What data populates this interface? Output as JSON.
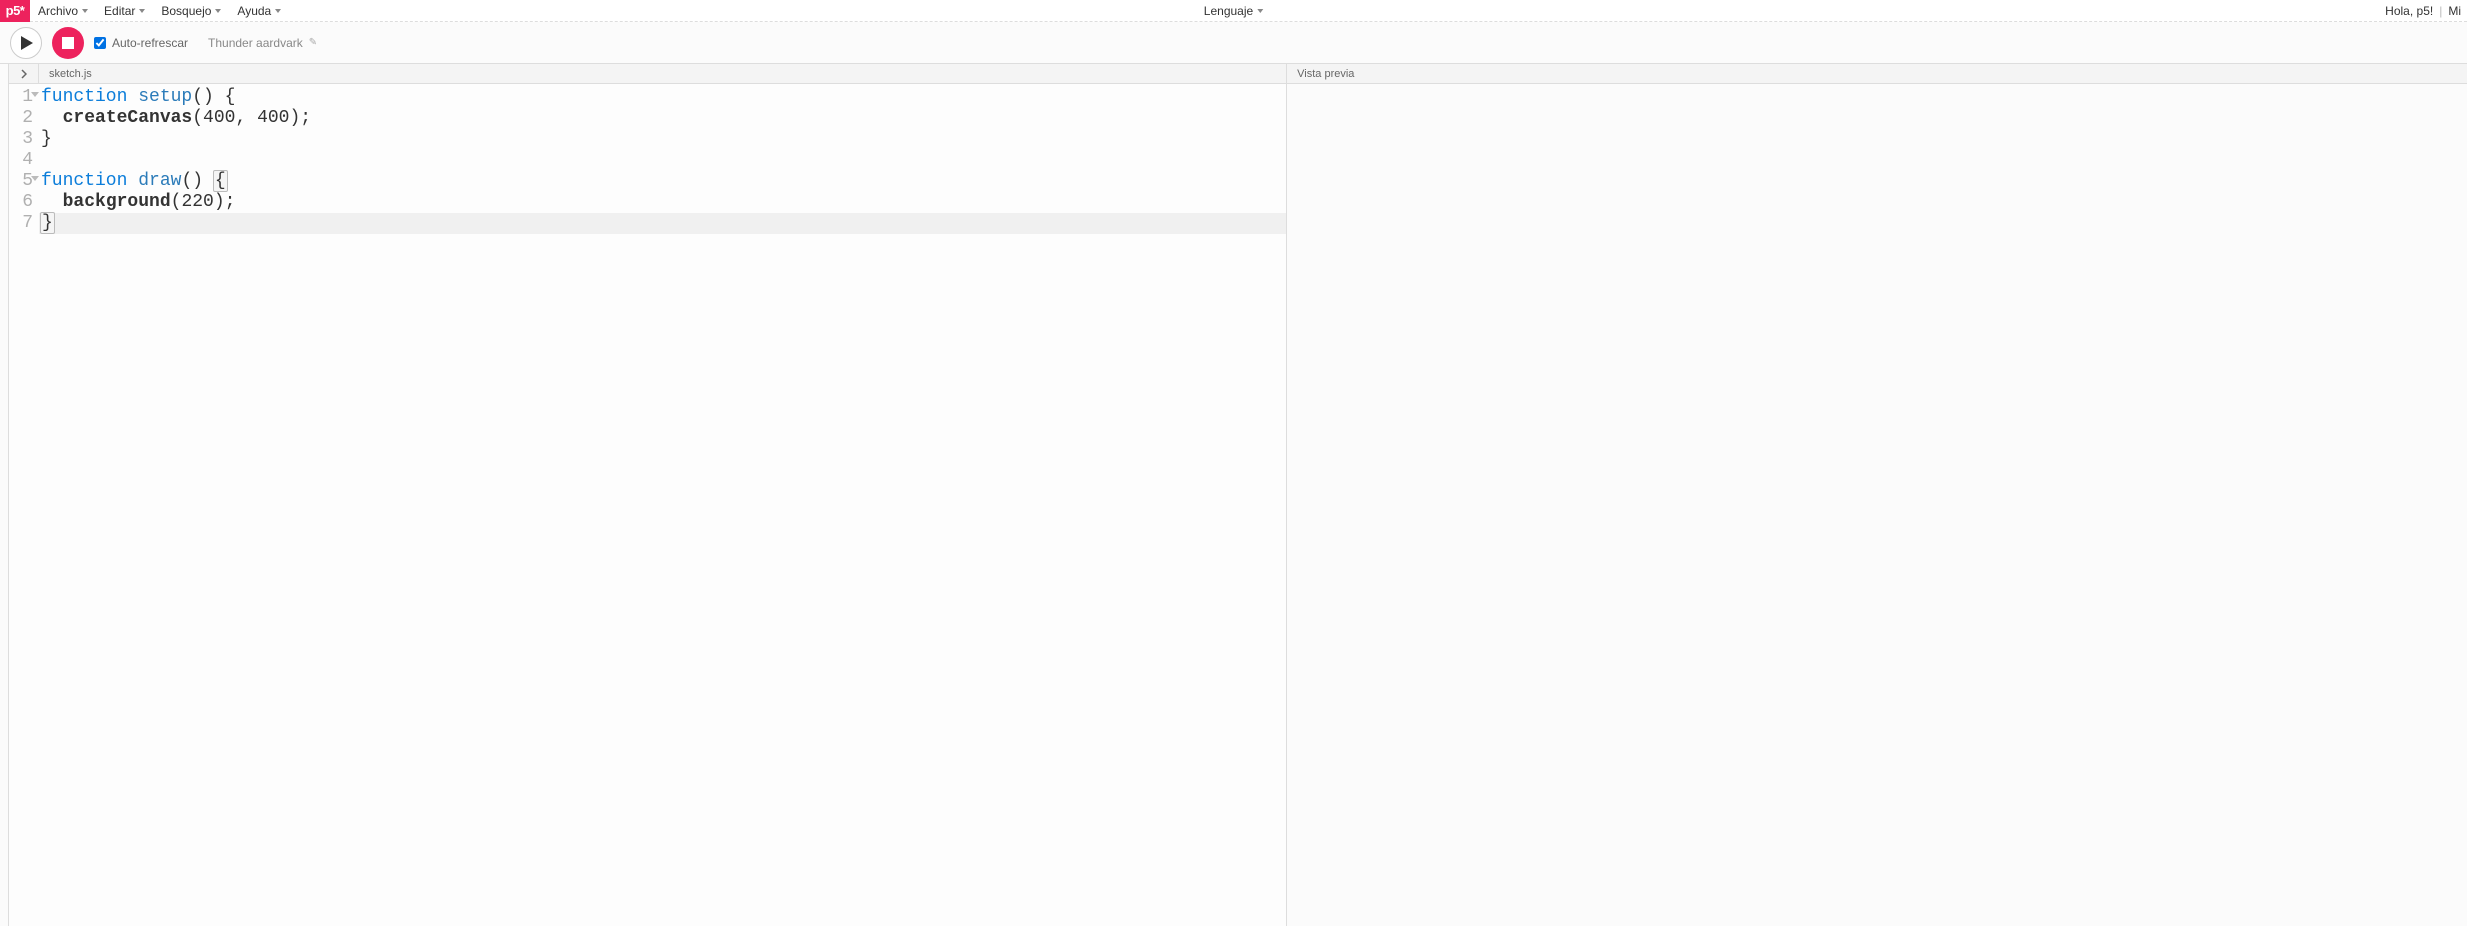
{
  "logo": "p5*",
  "menu": {
    "archivo": "Archivo",
    "editar": "Editar",
    "bosquejo": "Bosquejo",
    "ayuda": "Ayuda",
    "lenguaje": "Lenguaje"
  },
  "user": {
    "greeting": "Hola, p5!",
    "mi": "Mi"
  },
  "toolbar": {
    "auto_refresh": "Auto-refrescar",
    "auto_refresh_checked": true,
    "sketch_name": "Thunder aardvark"
  },
  "panes": {
    "filename": "sketch.js",
    "preview": "Vista previa"
  },
  "code": {
    "lines": [
      {
        "n": 1,
        "fold": true,
        "segments": [
          {
            "t": "function ",
            "c": "kw"
          },
          {
            "t": "setup",
            "c": "fn"
          },
          {
            "t": "() {",
            "c": ""
          }
        ]
      },
      {
        "n": 2,
        "fold": false,
        "segments": [
          {
            "t": "  ",
            "c": ""
          },
          {
            "t": "createCanvas",
            "c": "callfn"
          },
          {
            "t": "(",
            "c": ""
          },
          {
            "t": "400",
            "c": "num"
          },
          {
            "t": ", ",
            "c": ""
          },
          {
            "t": "400",
            "c": "num"
          },
          {
            "t": ");",
            "c": ""
          }
        ]
      },
      {
        "n": 3,
        "fold": false,
        "segments": [
          {
            "t": "}",
            "c": ""
          }
        ]
      },
      {
        "n": 4,
        "fold": false,
        "segments": [
          {
            "t": "",
            "c": ""
          }
        ]
      },
      {
        "n": 5,
        "fold": true,
        "segments": [
          {
            "t": "function ",
            "c": "kw"
          },
          {
            "t": "draw",
            "c": "fn"
          },
          {
            "t": "() ",
            "c": ""
          },
          {
            "t": "{",
            "c": "match"
          }
        ]
      },
      {
        "n": 6,
        "fold": false,
        "segments": [
          {
            "t": "  ",
            "c": ""
          },
          {
            "t": "background",
            "c": "callfn"
          },
          {
            "t": "(",
            "c": ""
          },
          {
            "t": "220",
            "c": "num"
          },
          {
            "t": ");",
            "c": ""
          }
        ]
      },
      {
        "n": 7,
        "fold": false,
        "active": true,
        "segments": [
          {
            "t": "}",
            "c": "match"
          }
        ]
      }
    ]
  }
}
